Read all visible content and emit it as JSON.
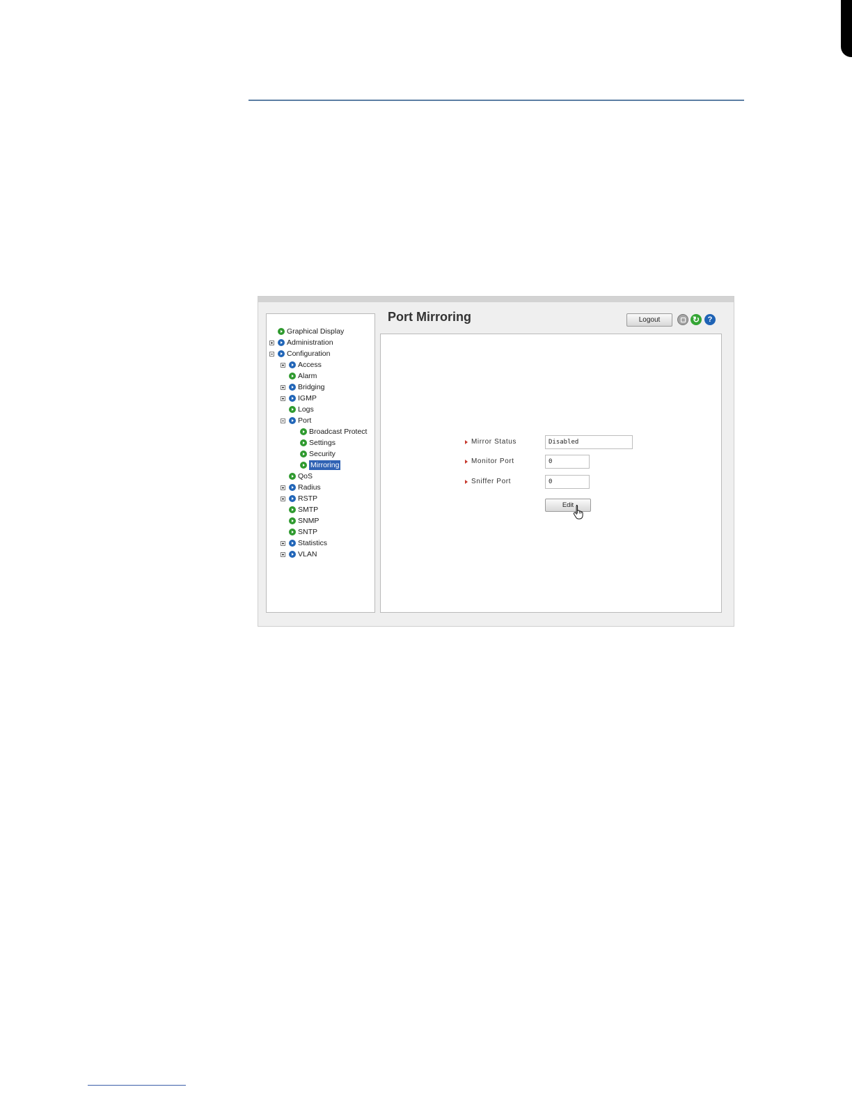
{
  "nav": {
    "items": [
      {
        "label": "Graphical Display",
        "level": 0,
        "expander": "none",
        "bullet": "green"
      },
      {
        "label": "Administration",
        "level": 0,
        "expander": "plus",
        "bullet": "blue"
      },
      {
        "label": "Configuration",
        "level": 0,
        "expander": "minus",
        "bullet": "blue"
      },
      {
        "label": "Access",
        "level": 1,
        "expander": "plus",
        "bullet": "blue"
      },
      {
        "label": "Alarm",
        "level": 1,
        "expander": "none",
        "bullet": "green"
      },
      {
        "label": "Bridging",
        "level": 1,
        "expander": "plus",
        "bullet": "blue"
      },
      {
        "label": "IGMP",
        "level": 1,
        "expander": "plus",
        "bullet": "blue"
      },
      {
        "label": "Logs",
        "level": 1,
        "expander": "none",
        "bullet": "green"
      },
      {
        "label": "Port",
        "level": 1,
        "expander": "minus",
        "bullet": "blue"
      },
      {
        "label": "Broadcast Protect",
        "level": 2,
        "expander": "none",
        "bullet": "green"
      },
      {
        "label": "Settings",
        "level": 2,
        "expander": "none",
        "bullet": "green"
      },
      {
        "label": "Security",
        "level": 2,
        "expander": "none",
        "bullet": "green"
      },
      {
        "label": "Mirroring",
        "level": 2,
        "expander": "none",
        "bullet": "green",
        "selected": true
      },
      {
        "label": "QoS",
        "level": 1,
        "expander": "none",
        "bullet": "green"
      },
      {
        "label": "Radius",
        "level": 1,
        "expander": "plus",
        "bullet": "blue"
      },
      {
        "label": "RSTP",
        "level": 1,
        "expander": "plus",
        "bullet": "blue"
      },
      {
        "label": "SMTP",
        "level": 1,
        "expander": "none",
        "bullet": "green"
      },
      {
        "label": "SNMP",
        "level": 1,
        "expander": "none",
        "bullet": "green"
      },
      {
        "label": "SNTP",
        "level": 1,
        "expander": "none",
        "bullet": "green"
      },
      {
        "label": "Statistics",
        "level": 1,
        "expander": "plus",
        "bullet": "blue"
      },
      {
        "label": "VLAN",
        "level": 1,
        "expander": "plus",
        "bullet": "blue"
      }
    ]
  },
  "header": {
    "title": "Port Mirroring",
    "logout_label": "Logout"
  },
  "form": {
    "mirror_status_label": "Mirror Status",
    "mirror_status_value": "Disabled",
    "monitor_port_label": "Monitor Port",
    "monitor_port_value": "0",
    "sniffer_port_label": "Sniffer Port",
    "sniffer_port_value": "0",
    "edit_label": "Edit"
  },
  "colors": {
    "selected": "#2f62b4",
    "bullet_green": "#2f9a2f",
    "bullet_blue": "#2266b8",
    "label_arrow": "#c63a2e"
  }
}
